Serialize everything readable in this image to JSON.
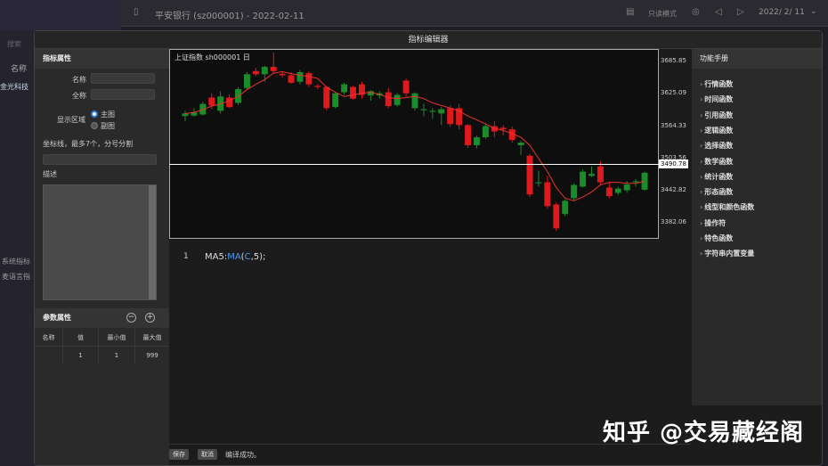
{
  "window": {
    "title": "平安银行 (sz000001) - 2022-02-11",
    "readonly_label": "只读模式",
    "date": "2022/ 2/ 11",
    "search_placeholder": "搜索",
    "name_col": "名称",
    "row_name": "金光科技",
    "sys_label": "系统指标",
    "mai_label": "麦语言指"
  },
  "dialog": {
    "title": "指标编辑器"
  },
  "attributes": {
    "header": "指标属性",
    "name_label": "名称",
    "fullname_label": "全称",
    "display_label": "显示区域",
    "option_main": "主图",
    "option_sub": "副图",
    "axis_label": "坐标线，最多7个，分号分割",
    "desc_label": "描述"
  },
  "params": {
    "header": "参数属性",
    "columns": [
      "名称",
      "值",
      "最小值",
      "最大值"
    ],
    "rows": [
      [
        "",
        "1",
        "1",
        "999"
      ]
    ]
  },
  "chart": {
    "title": "上证指数 sh000001  日",
    "price_labels": [
      "3685.85",
      "3625.09",
      "3564.33",
      "3503.56",
      "3442.82",
      "3382.06"
    ],
    "current_price": "3490.78"
  },
  "chart_data": {
    "type": "candlestick",
    "title": "上证指数 sh000001  日",
    "ylim": [
      3355,
      3710
    ],
    "ticks": [
      3685.85,
      3625.09,
      3564.33,
      3503.56,
      3442.82,
      3382.06
    ],
    "hline": 3490.78,
    "candles": [
      {
        "o": 3585,
        "h": 3595,
        "l": 3575,
        "c": 3590,
        "up": false
      },
      {
        "o": 3592,
        "h": 3600,
        "l": 3584,
        "c": 3586,
        "up": false
      },
      {
        "o": 3588,
        "h": 3612,
        "l": 3586,
        "c": 3608,
        "up": false
      },
      {
        "o": 3605,
        "h": 3628,
        "l": 3598,
        "c": 3620,
        "up": true
      },
      {
        "o": 3622,
        "h": 3632,
        "l": 3590,
        "c": 3595,
        "up": false
      },
      {
        "o": 3602,
        "h": 3626,
        "l": 3600,
        "c": 3620,
        "up": true
      },
      {
        "o": 3610,
        "h": 3640,
        "l": 3606,
        "c": 3636,
        "up": false
      },
      {
        "o": 3638,
        "h": 3668,
        "l": 3635,
        "c": 3664,
        "up": false
      },
      {
        "o": 3670,
        "h": 3676,
        "l": 3660,
        "c": 3664,
        "up": true
      },
      {
        "o": 3664,
        "h": 3680,
        "l": 3650,
        "c": 3678,
        "up": false
      },
      {
        "o": 3678,
        "h": 3705,
        "l": 3665,
        "c": 3670,
        "up": true
      },
      {
        "o": 3665,
        "h": 3668,
        "l": 3658,
        "c": 3662,
        "up": true
      },
      {
        "o": 3662,
        "h": 3668,
        "l": 3646,
        "c": 3648,
        "up": true
      },
      {
        "o": 3650,
        "h": 3672,
        "l": 3645,
        "c": 3668,
        "up": false
      },
      {
        "o": 3666,
        "h": 3670,
        "l": 3640,
        "c": 3645,
        "up": true
      },
      {
        "o": 3642,
        "h": 3646,
        "l": 3636,
        "c": 3640,
        "up": true
      },
      {
        "o": 3640,
        "h": 3642,
        "l": 3596,
        "c": 3600,
        "up": true
      },
      {
        "o": 3602,
        "h": 3630,
        "l": 3600,
        "c": 3628,
        "up": false
      },
      {
        "o": 3630,
        "h": 3648,
        "l": 3625,
        "c": 3645,
        "up": false
      },
      {
        "o": 3640,
        "h": 3642,
        "l": 3616,
        "c": 3618,
        "up": true
      },
      {
        "o": 3625,
        "h": 3650,
        "l": 3618,
        "c": 3645,
        "up": true
      },
      {
        "o": 3632,
        "h": 3634,
        "l": 3614,
        "c": 3624,
        "up": false
      },
      {
        "o": 3624,
        "h": 3632,
        "l": 3618,
        "c": 3628,
        "up": false
      },
      {
        "o": 3630,
        "h": 3638,
        "l": 3600,
        "c": 3604,
        "up": true
      },
      {
        "o": 3606,
        "h": 3628,
        "l": 3603,
        "c": 3625,
        "up": false
      },
      {
        "o": 3628,
        "h": 3656,
        "l": 3622,
        "c": 3652,
        "up": true
      },
      {
        "o": 3628,
        "h": 3630,
        "l": 3596,
        "c": 3600,
        "up": false
      },
      {
        "o": 3598,
        "h": 3608,
        "l": 3585,
        "c": 3596,
        "up": false
      },
      {
        "o": 3595,
        "h": 3600,
        "l": 3580,
        "c": 3593,
        "up": false
      },
      {
        "o": 3590,
        "h": 3602,
        "l": 3568,
        "c": 3598,
        "up": false
      },
      {
        "o": 3600,
        "h": 3605,
        "l": 3565,
        "c": 3570,
        "up": true
      },
      {
        "o": 3600,
        "h": 3608,
        "l": 3560,
        "c": 3568,
        "up": true
      },
      {
        "o": 3568,
        "h": 3570,
        "l": 3525,
        "c": 3530,
        "up": true
      },
      {
        "o": 3530,
        "h": 3548,
        "l": 3524,
        "c": 3545,
        "up": false
      },
      {
        "o": 3545,
        "h": 3570,
        "l": 3542,
        "c": 3566,
        "up": false
      },
      {
        "o": 3566,
        "h": 3575,
        "l": 3545,
        "c": 3556,
        "up": true
      },
      {
        "o": 3563,
        "h": 3568,
        "l": 3548,
        "c": 3560,
        "up": true
      },
      {
        "o": 3560,
        "h": 3565,
        "l": 3535,
        "c": 3540,
        "up": true
      },
      {
        "o": 3530,
        "h": 3538,
        "l": 3512,
        "c": 3535,
        "up": false
      },
      {
        "o": 3510,
        "h": 3514,
        "l": 3432,
        "c": 3437,
        "up": true
      },
      {
        "o": 3458,
        "h": 3482,
        "l": 3452,
        "c": 3460,
        "up": false
      },
      {
        "o": 3460,
        "h": 3472,
        "l": 3410,
        "c": 3415,
        "up": true
      },
      {
        "o": 3418,
        "h": 3422,
        "l": 3368,
        "c": 3373,
        "up": true
      },
      {
        "o": 3400,
        "h": 3428,
        "l": 3396,
        "c": 3425,
        "up": false
      },
      {
        "o": 3430,
        "h": 3458,
        "l": 3426,
        "c": 3455,
        "up": false
      },
      {
        "o": 3452,
        "h": 3484,
        "l": 3450,
        "c": 3480,
        "up": false
      },
      {
        "o": 3472,
        "h": 3490,
        "l": 3470,
        "c": 3476,
        "up": false
      },
      {
        "o": 3490,
        "h": 3500,
        "l": 3455,
        "c": 3460,
        "up": true
      },
      {
        "o": 3450,
        "h": 3460,
        "l": 3430,
        "c": 3434,
        "up": true
      },
      {
        "o": 3440,
        "h": 3452,
        "l": 3436,
        "c": 3448,
        "up": false
      },
      {
        "o": 3445,
        "h": 3462,
        "l": 3440,
        "c": 3456,
        "up": false
      },
      {
        "o": 3460,
        "h": 3466,
        "l": 3452,
        "c": 3462,
        "up": false
      },
      {
        "o": 3446,
        "h": 3480,
        "l": 3444,
        "c": 3478,
        "up": false
      }
    ],
    "ma5": [
      3590,
      3592,
      3597,
      3604,
      3608,
      3614,
      3622,
      3635,
      3645,
      3654,
      3666,
      3669,
      3665,
      3662,
      3660,
      3656,
      3640,
      3630,
      3622,
      3625,
      3628,
      3630,
      3626,
      3620,
      3618,
      3620,
      3622,
      3618,
      3610,
      3605,
      3600,
      3595,
      3585,
      3578,
      3570,
      3562,
      3558,
      3552,
      3545,
      3530,
      3505,
      3480,
      3450,
      3430,
      3425,
      3432,
      3442,
      3455,
      3460,
      3460,
      3458,
      3458,
      3462
    ]
  },
  "code": {
    "line_no": "1",
    "prefix": "MA5:",
    "fn": "MA",
    "open": "(",
    "arg": "C",
    "rest": ",5);"
  },
  "bottom": {
    "save": "保存",
    "cancel": "取消",
    "status": "编译成功。"
  },
  "manual": {
    "header": "功能手册",
    "items": [
      "行情函数",
      "时间函数",
      "引用函数",
      "逻辑函数",
      "选择函数",
      "数学函数",
      "统计函数",
      "形态函数",
      "线型和颜色函数",
      "操作符",
      "特色函数",
      "字符串内置变量"
    ]
  },
  "watermark": "知乎 @交易藏经阁",
  "colors": {
    "up": "#e0191d",
    "down": "#1a8c2a",
    "ma": "#e8342e",
    "price_box": "#ffffff"
  }
}
